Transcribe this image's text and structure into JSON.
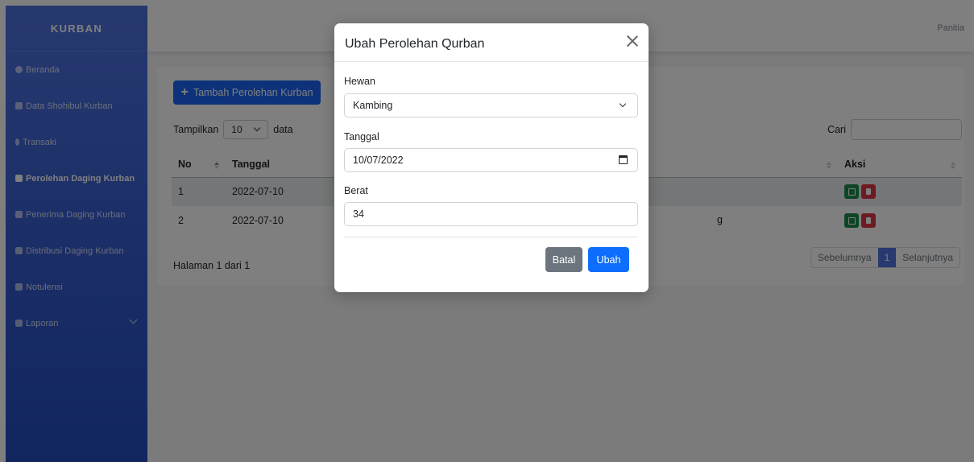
{
  "sidebar": {
    "brand": "KURBAN",
    "items": [
      {
        "label": "Beranda"
      },
      {
        "label": "Data Shohibul Kurban"
      },
      {
        "label": "Transaki"
      },
      {
        "label": "Perolehan Daging Kurban"
      },
      {
        "label": "Penerima Daging Kurban"
      },
      {
        "label": "Distribusi Daging Kurban"
      },
      {
        "label": "Notulensi"
      },
      {
        "label": "Laporan"
      }
    ]
  },
  "topbar": {
    "user": "Panitia"
  },
  "main": {
    "add_button": "Tambah Perolehan Kurban",
    "length": {
      "prefix": "Tampilkan",
      "value": "10",
      "suffix": "data"
    },
    "search_label": "Cari",
    "columns": {
      "no": "No",
      "tanggal": "Tanggal",
      "aksi": "Aksi"
    },
    "rows": [
      {
        "no": "1",
        "tanggal": "2022-07-10",
        "hewan": ""
      },
      {
        "no": "2",
        "tanggal": "2022-07-10",
        "hewan": "g"
      }
    ],
    "info": "Halaman 1 dari 1",
    "pager": {
      "prev": "Sebelumnya",
      "current": "1",
      "next": "Selanjutnya"
    }
  },
  "modal": {
    "title": "Ubah Perolehan Qurban",
    "hewan_label": "Hewan",
    "hewan_value": "Kambing",
    "tanggal_label": "Tanggal",
    "tanggal_value": "10/07/2022",
    "berat_label": "Berat",
    "berat_value": "34",
    "cancel": "Batal",
    "submit": "Ubah"
  },
  "colors": {
    "sidebar_top": "#4e73df",
    "sidebar_bottom": "#224abe",
    "primary": "#0d6efd",
    "secondary": "#6c757d",
    "success": "#1c8a4a",
    "danger": "#dc3545"
  },
  "icons": {
    "nav": [
      "dashboard-icon",
      "users-icon",
      "dollar-icon",
      "clipboard-icon",
      "people-icon",
      "truck-icon",
      "notes-icon",
      "report-icon"
    ]
  }
}
